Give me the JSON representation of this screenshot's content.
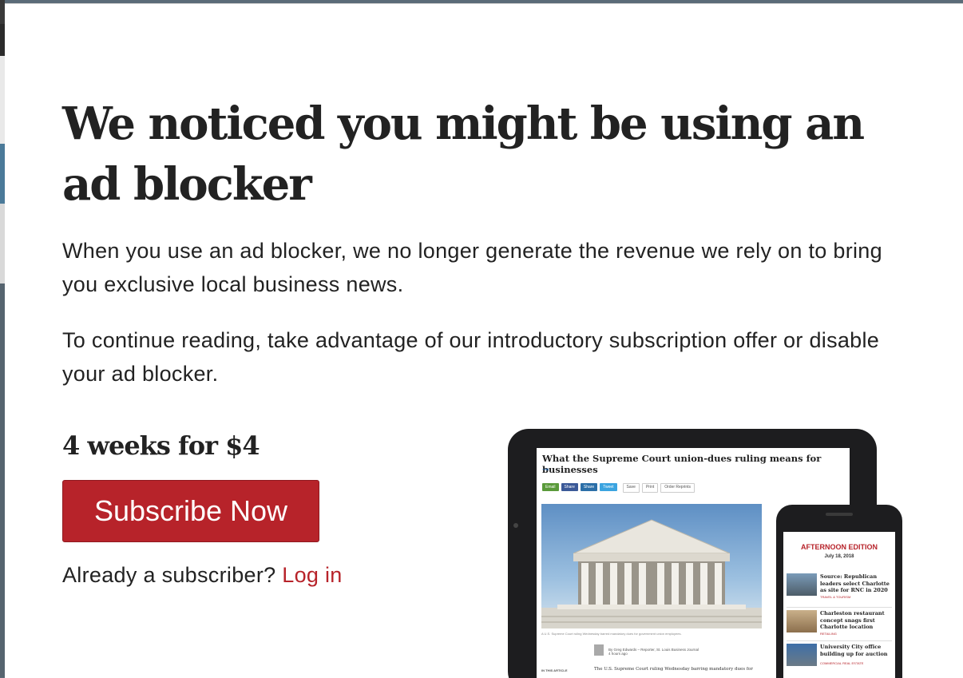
{
  "modal": {
    "headline": "We noticed you might be using an ad blocker",
    "paragraph1": "When you use an ad blocker, we no longer generate the revenue we rely on to bring you exclusive local business news.",
    "paragraph2": "To continue reading, take advantage of our introductory subscription offer or disable your ad blocker.",
    "offer": "4 weeks for $4",
    "subscribe_label": "Subscribe Now",
    "already_text": "Already a subscriber?",
    "login_label": "Log in"
  },
  "colors": {
    "accent": "#b7232a",
    "text": "#222222"
  },
  "tablet": {
    "article_title": "What the Supreme Court union-dues ruling means for businesses",
    "share_buttons": [
      "Email",
      "Share",
      "Share",
      "Tweet"
    ],
    "tool_buttons": [
      "Save",
      "Print",
      "Order Reprints"
    ],
    "caption": "A U.S. Supreme Court ruling Wednesday barred mandatory dues for government union employees.",
    "byline": "By Greg Edwards – Reporter, St. Louis Business Journal",
    "time_ago": "4 hours ago",
    "in_this_article": "IN THIS ARTICLE",
    "body_start": "The U.S. Supreme Court ruling Wednesday barring mandatory dues for"
  },
  "phone": {
    "edition": "AFTERNOON EDITION",
    "date": "July 18, 2018",
    "stories": [
      {
        "headline": "Source: Republican leaders select Charlotte as site for RNC in 2020",
        "tag": "TRAVEL & TOURISM"
      },
      {
        "headline": "Charleston restaurant concept snags first Charlotte location",
        "tag": "RETAILING"
      },
      {
        "headline": "University City office building up for auction",
        "tag": "COMMERCIAL REAL ESTATE"
      }
    ]
  }
}
